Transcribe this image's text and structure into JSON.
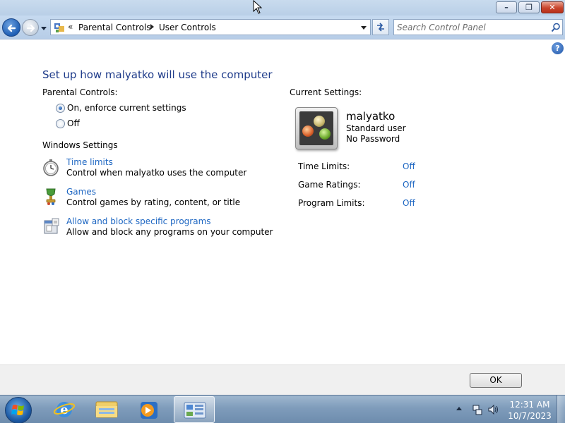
{
  "window": {
    "controls": {
      "minimize": "–",
      "maximize": "❐",
      "close": "✕"
    }
  },
  "navbar": {
    "overflow_chevron": "«",
    "breadcrumbs": [
      "Parental Controls",
      "User Controls"
    ],
    "search_placeholder": "Search Control Panel"
  },
  "main": {
    "title": "Set up how malyatko will use the computer",
    "parental_controls": {
      "heading": "Parental Controls:",
      "options": [
        {
          "label": "On, enforce current settings",
          "checked": true
        },
        {
          "label": "Off",
          "checked": false
        }
      ]
    },
    "windows_settings": {
      "heading": "Windows Settings",
      "items": [
        {
          "icon": "stopwatch-icon",
          "link": "Time limits",
          "description": "Control when malyatko uses the computer"
        },
        {
          "icon": "games-trophy-icon",
          "link": "Games",
          "description": "Control games by rating, content, or title"
        },
        {
          "icon": "programs-icon",
          "link": "Allow and block specific programs",
          "description": "Allow and block any programs on your computer"
        }
      ]
    },
    "current_settings": {
      "heading": "Current Settings:",
      "user": {
        "name": "malyatko",
        "account_type": "Standard user",
        "password": "No Password"
      },
      "rows": [
        {
          "label": "Time Limits:",
          "value": "Off"
        },
        {
          "label": "Game Ratings:",
          "value": "Off"
        },
        {
          "label": "Program Limits:",
          "value": "Off"
        }
      ]
    }
  },
  "footer": {
    "ok_label": "OK"
  },
  "taskbar": {
    "items": [
      "internet-explorer-icon",
      "windows-explorer-icon",
      "media-player-icon",
      "control-panel-icon"
    ],
    "clock": {
      "time": "12:31 AM",
      "date": "10/7/2023"
    }
  },
  "colors": {
    "title": "#1e3b8a",
    "link": "#1d66c2"
  }
}
